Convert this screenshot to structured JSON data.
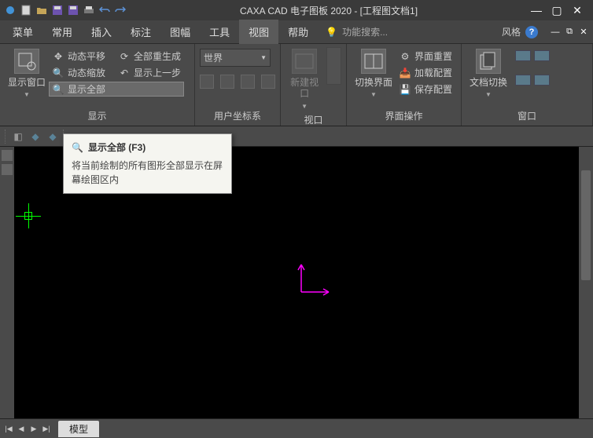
{
  "title": "CAXA CAD 电子图板 2020 - [工程图文档1]",
  "menu": {
    "items": [
      "菜单",
      "常用",
      "插入",
      "标注",
      "图幅",
      "工具",
      "视图",
      "帮助"
    ],
    "active": 6,
    "search_placeholder": "功能搜索...",
    "style_label": "风格"
  },
  "ribbon": {
    "g1": {
      "big": "显示窗口",
      "items": [
        "动态平移",
        "全部重生成",
        "动态缩放",
        "显示上一步",
        "显示全部"
      ],
      "label": "显示"
    },
    "g2": {
      "dropdown": "世界",
      "label": "用户坐标系"
    },
    "g3": {
      "big": "新建视口",
      "label": "视口"
    },
    "g4": {
      "big": "切换界面",
      "items": [
        "界面重置",
        "加载配置",
        "保存配置"
      ],
      "label": "界面操作"
    },
    "g5": {
      "big": "文档切换",
      "label": "窗口"
    }
  },
  "tooltip": {
    "title": "显示全部 (F3)",
    "body": "将当前绘制的所有图形全部显示在屏幕绘图区内"
  },
  "bottom": {
    "tab": "模型"
  }
}
